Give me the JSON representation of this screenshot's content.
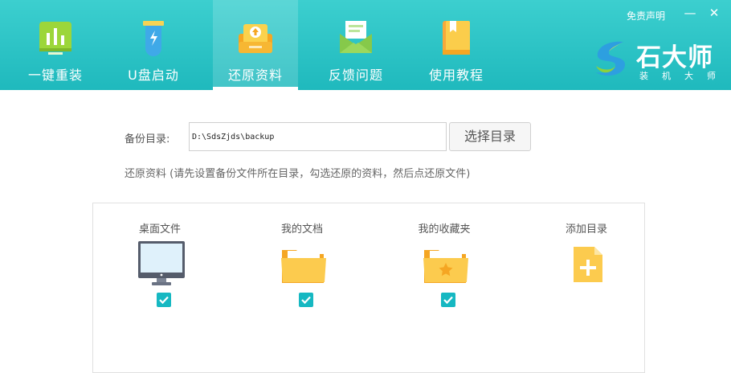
{
  "header": {
    "tabs": [
      {
        "label": "一键重装",
        "icon": "chart-bars-icon"
      },
      {
        "label": "U盘启动",
        "icon": "usb-drive-icon"
      },
      {
        "label": "还原资料",
        "icon": "restore-box-icon",
        "active": true
      },
      {
        "label": "反馈问题",
        "icon": "envelope-icon"
      },
      {
        "label": "使用教程",
        "icon": "book-icon"
      }
    ],
    "disclaimer": "免责声明",
    "minimize_glyph": "—",
    "close_glyph": "✕",
    "brand": {
      "name": "石大师",
      "sub": "装机大师"
    }
  },
  "backup": {
    "label": "备份目录:",
    "path": "D:\\SdsZjds\\backup",
    "choose_button": "选择目录",
    "hint": "还原资料 (请先设置备份文件所在目录，勾选还原的资料，然后点还原文件)"
  },
  "folders": [
    {
      "label": "桌面文件",
      "icon": "monitor-icon",
      "checked": true
    },
    {
      "label": "我的文档",
      "icon": "folder-icon",
      "checked": true
    },
    {
      "label": "我的收藏夹",
      "icon": "favorites-folder-icon",
      "checked": true
    },
    {
      "label": "添加目录",
      "icon": "add-file-icon",
      "checked": false
    }
  ],
  "colors": {
    "header": "#22bcc0",
    "checkbox": "#16b8c2",
    "folder_yellow": "#f9c74a"
  }
}
